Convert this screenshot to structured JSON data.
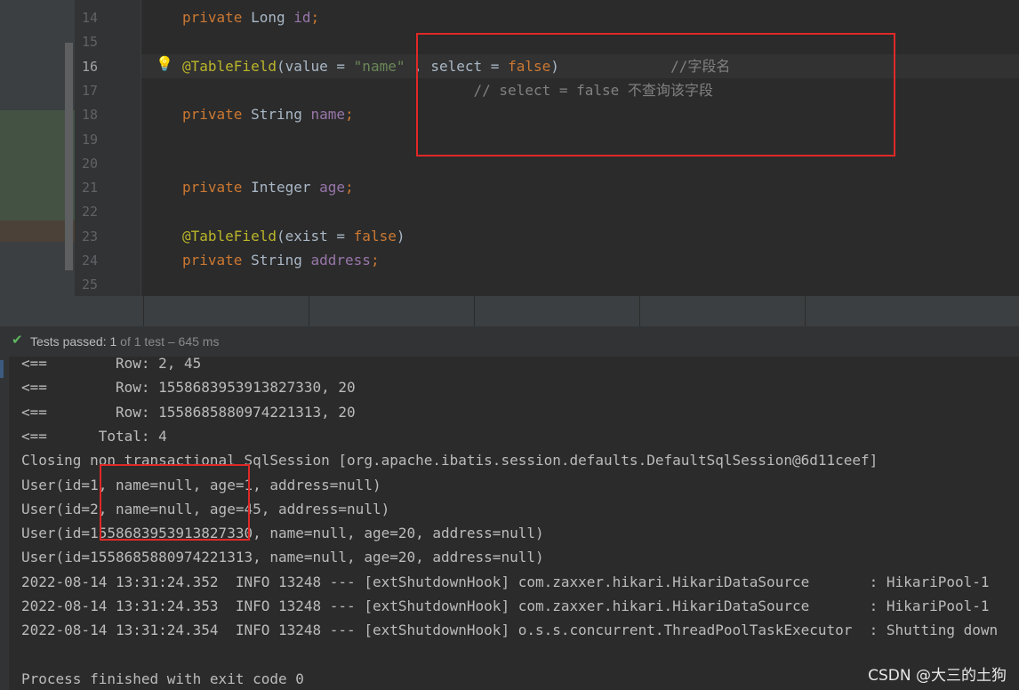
{
  "editor": {
    "current_line": 16,
    "lines": [
      {
        "num": "14",
        "tokens": [
          {
            "t": "private ",
            "c": "kw"
          },
          {
            "t": "Long ",
            "c": "plain"
          },
          {
            "t": "id",
            "c": "fld"
          },
          {
            "t": ";",
            "c": "kw"
          }
        ]
      },
      {
        "num": "15",
        "tokens": []
      },
      {
        "num": "16",
        "tokens": [
          {
            "t": "@TableField",
            "c": "ann"
          },
          {
            "t": "(value = ",
            "c": "plain"
          },
          {
            "t": "\"name\"",
            "c": "str"
          },
          {
            "t": " , select = ",
            "c": "plain"
          },
          {
            "t": "false",
            "c": "kw"
          },
          {
            "t": ")             ",
            "c": "plain"
          },
          {
            "t": "//字段名",
            "c": "cmt"
          }
        ]
      },
      {
        "num": "17",
        "tokens": [
          {
            "t": "                                  // select = false 不查询该字段",
            "c": "cmt"
          }
        ]
      },
      {
        "num": "18",
        "tokens": [
          {
            "t": "private ",
            "c": "kw"
          },
          {
            "t": "String ",
            "c": "plain"
          },
          {
            "t": "name",
            "c": "fld"
          },
          {
            "t": ";",
            "c": "kw"
          }
        ]
      },
      {
        "num": "19",
        "tokens": []
      },
      {
        "num": "20",
        "tokens": []
      },
      {
        "num": "21",
        "tokens": [
          {
            "t": "private ",
            "c": "kw"
          },
          {
            "t": "Integer ",
            "c": "plain"
          },
          {
            "t": "age",
            "c": "fld"
          },
          {
            "t": ";",
            "c": "kw"
          }
        ]
      },
      {
        "num": "22",
        "tokens": []
      },
      {
        "num": "23",
        "tokens": [
          {
            "t": "@TableField",
            "c": "ann"
          },
          {
            "t": "(exist = ",
            "c": "plain"
          },
          {
            "t": "false",
            "c": "kw"
          },
          {
            "t": ")",
            "c": "plain"
          }
        ]
      },
      {
        "num": "24",
        "tokens": [
          {
            "t": "private ",
            "c": "kw"
          },
          {
            "t": "String ",
            "c": "plain"
          },
          {
            "t": "address",
            "c": "fld"
          },
          {
            "t": ";",
            "c": "kw"
          }
        ]
      },
      {
        "num": "25",
        "tokens": []
      }
    ]
  },
  "test_status": {
    "label": "Tests passed: ",
    "passed": "1",
    "detail": " of 1 test – 645 ms"
  },
  "console": {
    "lines": [
      "<==        Row: 2, 45",
      "<==        Row: 1558683953913827330, 20",
      "<==        Row: 1558685880974221313, 20",
      "<==      Total: 4",
      "Closing non transactional SqlSession [org.apache.ibatis.session.defaults.DefaultSqlSession@6d11ceef]",
      "User(id=1, name=null, age=1, address=null)",
      "User(id=2, name=null, age=45, address=null)",
      "User(id=1558683953913827330, name=null, age=20, address=null)",
      "User(id=1558685880974221313, name=null, age=20, address=null)",
      "2022-08-14 13:31:24.352  INFO 13248 --- [extShutdownHook] com.zaxxer.hikari.HikariDataSource       : HikariPool-1",
      "2022-08-14 13:31:24.353  INFO 13248 --- [extShutdownHook] com.zaxxer.hikari.HikariDataSource       : HikariPool-1",
      "2022-08-14 13:31:24.354  INFO 13248 --- [extShutdownHook] o.s.s.concurrent.ThreadPoolTaskExecutor  : Shutting down",
      "",
      "Process finished with exit code 0"
    ]
  },
  "watermark": "CSDN @大三的土狗",
  "colors": {
    "keyword": "#cc7832",
    "annotation": "#bbb529",
    "string": "#6a8759",
    "field": "#9876aa",
    "comment": "#808080",
    "highlight_box": "#e02828",
    "pass_check": "#5fb85f"
  },
  "icons": [
    "lightbulb-icon",
    "check-icon"
  ]
}
